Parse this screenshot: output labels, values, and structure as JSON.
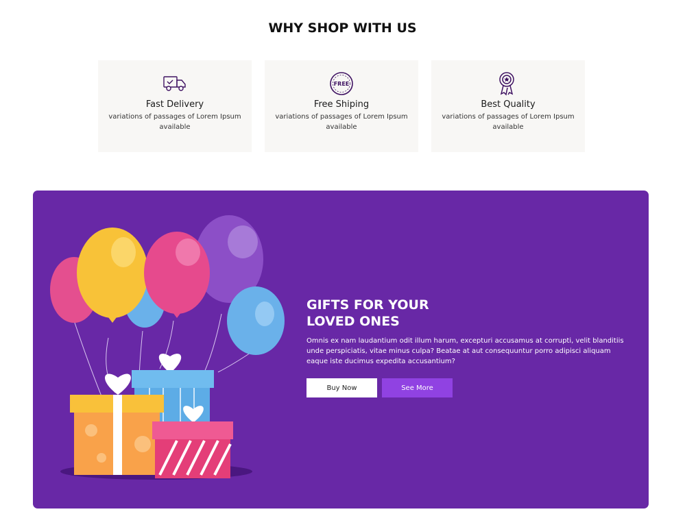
{
  "section": {
    "title": "WHY SHOP WITH US"
  },
  "features": [
    {
      "icon": "delivery-truck-icon",
      "title": "Fast Delivery",
      "desc": "variations of passages of Lorem Ipsum available"
    },
    {
      "icon": "free-badge-icon",
      "title": "Free Shiping",
      "desc": "variations of passages of Lorem Ipsum available"
    },
    {
      "icon": "quality-medal-icon",
      "title": "Best Quality",
      "desc": "variations of passages of Lorem Ipsum available"
    }
  ],
  "banner": {
    "title": "GIFTS FOR YOUR LOVED ONES",
    "description": "Omnis ex nam laudantium odit illum harum, excepturi accusamus at corrupti, velit blanditiis unde perspiciatis, vitae minus culpa? Beatae at aut consequuntur porro adipisci aliquam eaque iste ducimus expedita accusantium?",
    "buy_label": "Buy Now",
    "more_label": "See More",
    "colors": {
      "background": "#6828a6",
      "accent": "#9042e2"
    }
  }
}
